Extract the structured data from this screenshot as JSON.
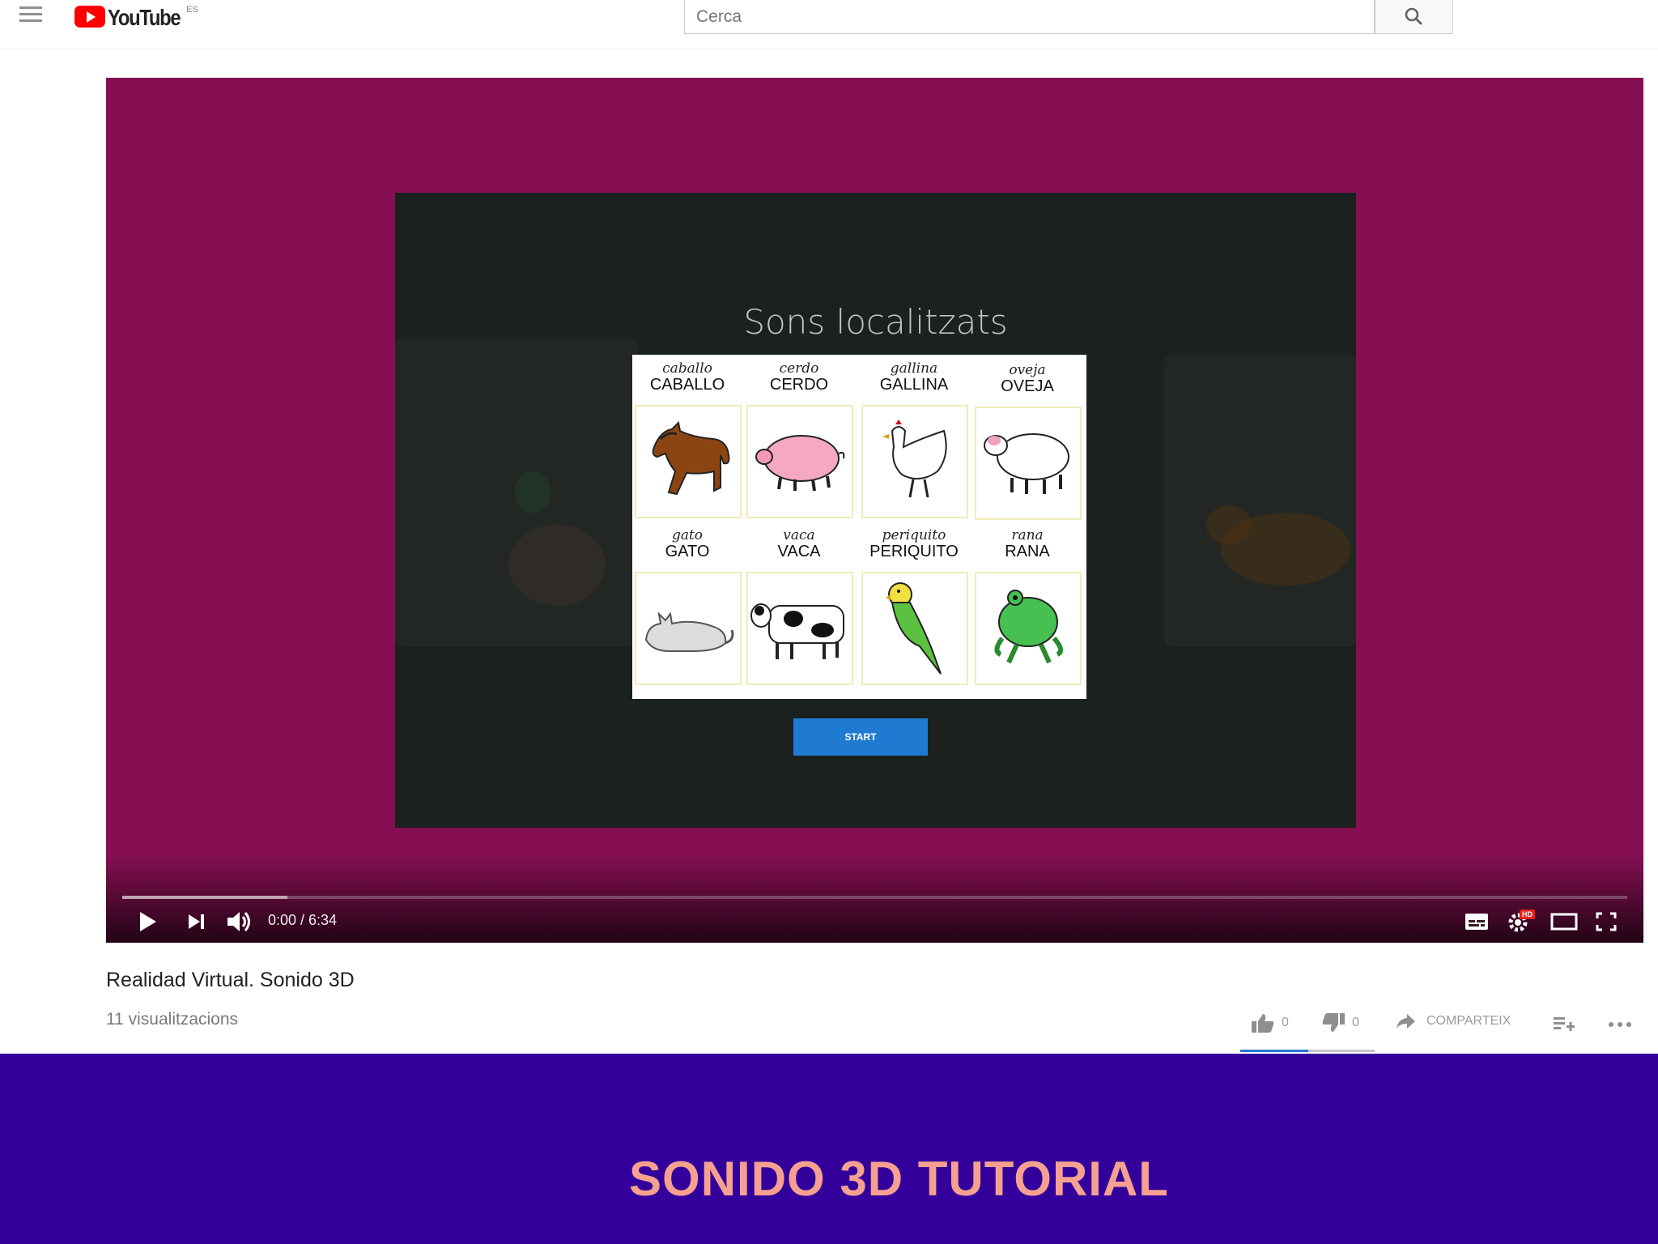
{
  "header": {
    "logo_text": "YouTube",
    "logo_country": "ES",
    "search_placeholder": "Cerca"
  },
  "video_slide": {
    "title": "Sons localitzats",
    "animals": [
      {
        "cursive": "caballo",
        "caps": "CABALLO",
        "icon": "horse-icon"
      },
      {
        "cursive": "cerdo",
        "caps": "CERDO",
        "icon": "pig-icon"
      },
      {
        "cursive": "gallina",
        "caps": "GALLINA",
        "icon": "hen-icon"
      },
      {
        "cursive": "oveja",
        "caps": "OVEJA",
        "icon": "sheep-icon"
      },
      {
        "cursive": "gato",
        "caps": "GATO",
        "icon": "cat-icon"
      },
      {
        "cursive": "vaca",
        "caps": "VACA",
        "icon": "cow-icon"
      },
      {
        "cursive": "periquito",
        "caps": "PERIQUITO",
        "icon": "parakeet-icon"
      },
      {
        "cursive": "rana",
        "caps": "RANA",
        "icon": "frog-icon"
      }
    ],
    "start_label": "START"
  },
  "player": {
    "time": "0:00 / 6:34",
    "progress_fraction": 0.0,
    "buffered_fraction": 0.11,
    "settings_badge": "HD"
  },
  "video_info": {
    "title": "Realidad Virtual. Sonido 3D",
    "views": "11 visualitzacions",
    "likes": "0",
    "dislikes": "0",
    "share_label": "COMPARTEIX"
  },
  "banner": {
    "title": "SONIDO 3D TUTORIAL"
  },
  "colors": {
    "player_bg": "#850f52",
    "banner_bg": "#34009b",
    "banner_text": "#f6a091",
    "start_button": "#1f7bd2",
    "youtube_red": "#ff0000"
  }
}
